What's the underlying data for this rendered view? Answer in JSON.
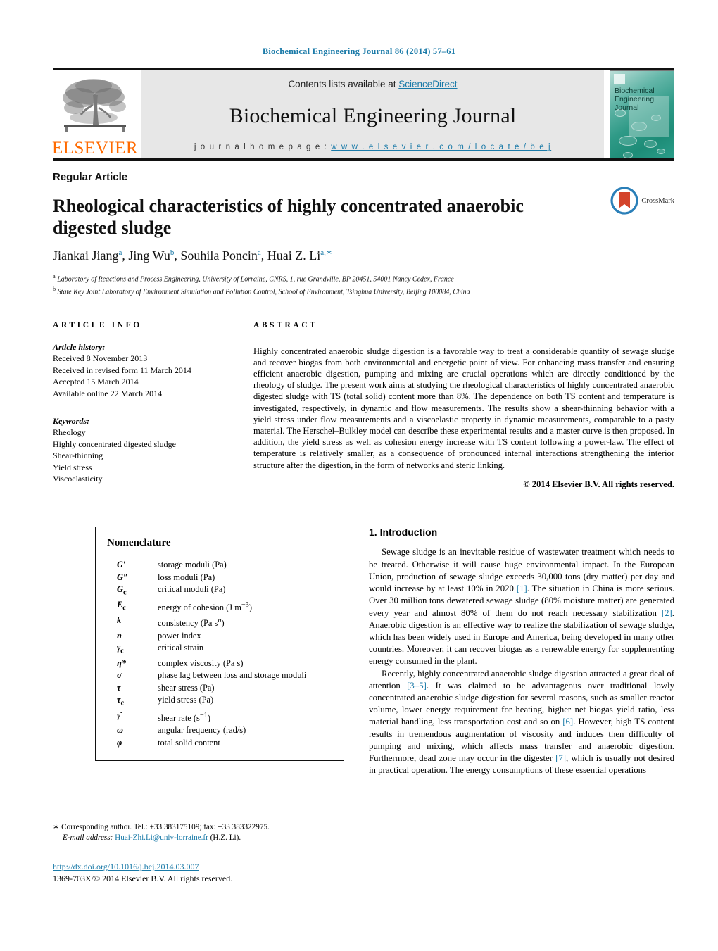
{
  "running_head": "Biochemical Engineering Journal 86 (2014) 57–61",
  "masthead": {
    "contents_prefix": "Contents lists available at ",
    "sciencedirect": "ScienceDirect",
    "journal_title": "Biochemical Engineering Journal",
    "homepage_prefix": "j o u r n a l   h o m e p a g e :   ",
    "homepage_url": "w w w . e l s e v i e r . c o m / l o c a t e / b e j",
    "publisher": "ELSEVIER",
    "cover_title_line1": "Biochemical",
    "cover_title_line2": "Engineering",
    "cover_title_line3": "Journal"
  },
  "article": {
    "type": "Regular Article",
    "title": "Rheological characteristics of highly concentrated anaerobic digested sludge",
    "authors_html": "Jiankai Jiang<sup>a</sup>, Jing Wu<sup>b</sup>, Souhila Poncin<sup>a</sup>, Huai Z. Li<sup>a,∗</sup>",
    "affiliation_a": "Laboratory of Reactions and Process Engineering, University of Lorraine, CNRS, 1, rue Grandville, BP 20451, 54001 Nancy Cedex, France",
    "affiliation_b": "State Key Joint Laboratory of Environment Simulation and Pollution Control, School of Environment, Tsinghua University, Beijing 100084, China",
    "crossmark_label": "CrossMark"
  },
  "article_info": {
    "heading": "ARTICLE INFO",
    "history_title": "Article history:",
    "history": [
      "Received 8 November 2013",
      "Received in revised form 11 March 2014",
      "Accepted 15 March 2014",
      "Available online 22 March 2014"
    ],
    "keywords_title": "Keywords:",
    "keywords": [
      "Rheology",
      "Highly concentrated digested sludge",
      "Shear-thinning",
      "Yield stress",
      "Viscoelasticity"
    ]
  },
  "abstract": {
    "heading": "ABSTRACT",
    "text": "Highly concentrated anaerobic sludge digestion is a favorable way to treat a considerable quantity of sewage sludge and recover biogas from both environmental and energetic point of view. For enhancing mass transfer and ensuring efficient anaerobic digestion, pumping and mixing are crucial operations which are directly conditioned by the rheology of sludge. The present work aims at studying the rheological characteristics of highly concentrated anaerobic digested sludge with TS (total solid) content more than 8%. The dependence on both TS content and temperature is investigated, respectively, in dynamic and flow measurements. The results show a shear-thinning behavior with a yield stress under flow measurements and a viscoelastic property in dynamic measurements, comparable to a pasty material. The Herschel–Bulkley model can describe these experimental results and a master curve is then proposed. In addition, the yield stress as well as cohesion energy increase with TS content following a power-law. The effect of temperature is relatively smaller, as a consequence of pronounced internal interactions strengthening the interior structure after the digestion, in the form of networks and steric linking.",
    "copyright": "© 2014 Elsevier B.V. All rights reserved."
  },
  "nomenclature": {
    "heading": "Nomenclature",
    "entries": [
      {
        "symbol": "G′",
        "definition": "storage moduli (Pa)"
      },
      {
        "symbol": "G″",
        "definition": "loss moduli (Pa)"
      },
      {
        "symbol": "Gᴄ",
        "definition": "critical moduli (Pa)"
      },
      {
        "symbol": "Eᴄ",
        "definition": "energy of cohesion (J m⁻³)"
      },
      {
        "symbol": "k",
        "definition": "consistency (Pa sⁿ)"
      },
      {
        "symbol": "n",
        "definition": "power index"
      },
      {
        "symbol": "γᴄ",
        "definition": "critical strain"
      },
      {
        "symbol": "η*",
        "definition": "complex viscosity (Pa s)"
      },
      {
        "symbol": "σ",
        "definition": "phase lag between loss and storage moduli"
      },
      {
        "symbol": "τ",
        "definition": "shear stress (Pa)"
      },
      {
        "symbol": "τᴄ",
        "definition": "yield stress (Pa)"
      },
      {
        "symbol": "γ̇",
        "definition": "shear rate (s⁻¹)"
      },
      {
        "symbol": "ω",
        "definition": "angular frequency (rad/s)"
      },
      {
        "symbol": "φ",
        "definition": "total solid content"
      }
    ]
  },
  "introduction": {
    "heading": "1.  Introduction",
    "paragraphs": [
      "Sewage sludge is an inevitable residue of wastewater treatment which needs to be treated. Otherwise it will cause huge environmental impact. In the European Union, production of sewage sludge exceeds 30,000 tons (dry matter) per day and would increase by at least 10% in 2020 [1]. The situation in China is more serious. Over 30 million tons dewatered sewage sludge (80% moisture matter) are generated every year and almost 80% of them do not reach necessary stabilization [2]. Anaerobic digestion is an effective way to realize the stabilization of sewage sludge, which has been widely used in Europe and America, being developed in many other countries. Moreover, it can recover biogas as a renewable energy for supplementing energy consumed in the plant.",
      "Recently, highly concentrated anaerobic sludge digestion attracted a great deal of attention [3–5]. It was claimed to be advantageous over traditional lowly concentrated anaerobic sludge digestion for several reasons, such as smaller reactor volume, lower energy requirement for heating, higher net biogas yield ratio, less material handling, less transportation cost and so on [6]. However, high TS content results in tremendous augmentation of viscosity and induces then difficulty of pumping and mixing, which affects mass transfer and anaerobic digestion. Furthermore, dead zone may occur in the digester [7], which is usually not desired in practical operation. The energy consumptions of these essential operations"
    ],
    "citations": [
      "[1]",
      "[2]",
      "[3–5]",
      "[6]",
      "[7]"
    ]
  },
  "footer": {
    "corresponding_marker": "∗",
    "corresponding": "Corresponding author. Tel.: +33 383175109; fax: +33 383322975.",
    "email_label": "E-mail address:",
    "email": "Huai-Zhi.Li@univ-lorraine.fr",
    "email_suffix": "(H.Z. Li).",
    "doi": "http://dx.doi.org/10.1016/j.bej.2014.03.007",
    "issn": "1369-703X/© 2014 Elsevier B.V. All rights reserved."
  },
  "colors": {
    "link": "#1a7aa8",
    "elsevier_orange": "#ff6a00",
    "cover_teal": "#2f9a87",
    "crossmark_blue": "#2a7fb8",
    "crossmark_red": "#d4432a"
  }
}
